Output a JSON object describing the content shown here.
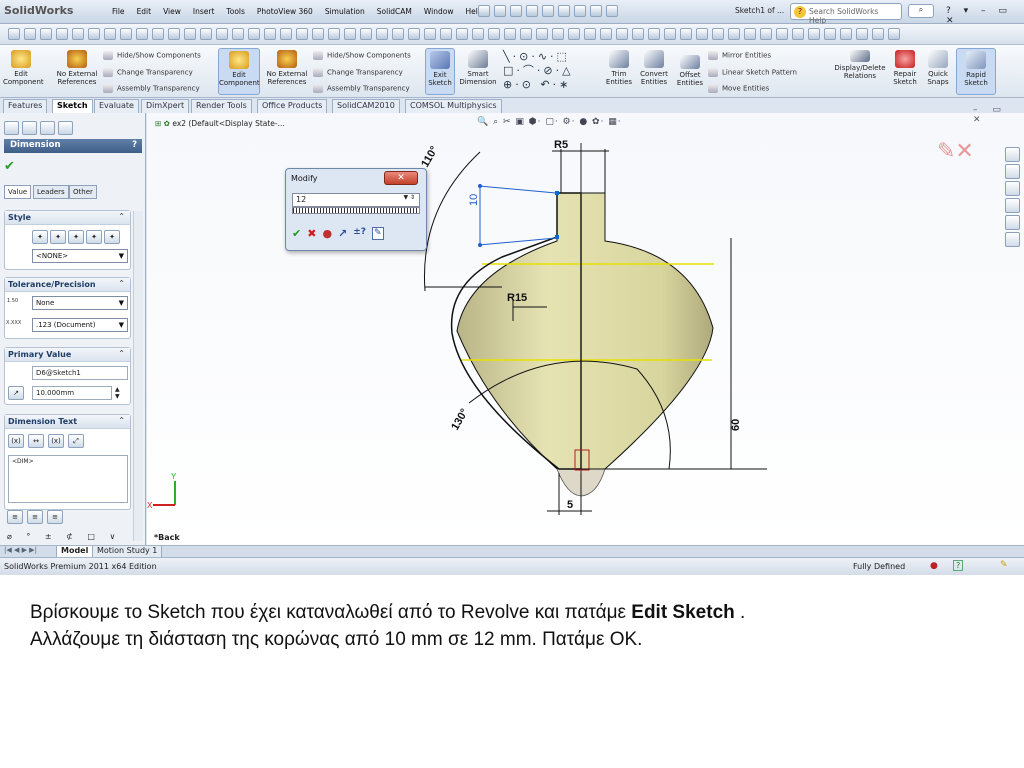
{
  "app": {
    "logo": "SolidWorks",
    "menu": [
      "File",
      "Edit",
      "View",
      "Insert",
      "Tools",
      "PhotoView 360",
      "Simulation",
      "SolidCAM",
      "Window",
      "Help"
    ],
    "doc_title": "Sketch1 of ...",
    "search_placeholder": "Search SolidWorks Help"
  },
  "ribbon": {
    "edit_component": "Edit Component",
    "no_external_refs": "No External References",
    "hide_show": "Hide/Show Components",
    "change_transparency": "Change Transparency",
    "assembly_transparency": "Assembly Transparency",
    "exit_sketch": "Exit Sketch",
    "smart_dimension": "Smart Dimension",
    "trim_entities": "Trim Entities",
    "convert_entities": "Convert Entities",
    "offset_entities": "Offset Entities",
    "mirror_entities": "Mirror Entities",
    "linear_pattern": "Linear Sketch Pattern",
    "move_entities": "Move Entities",
    "display_delete_relations": "Display/Delete Relations",
    "repair_sketch": "Repair Sketch",
    "quick_snaps": "Quick Snaps",
    "rapid_sketch": "Rapid Sketch"
  },
  "tabs": [
    "Features",
    "Sketch",
    "Evaluate",
    "DimXpert",
    "Render Tools",
    "Office Products",
    "SolidCAM2010",
    "COMSOL Multiphysics"
  ],
  "property_manager": {
    "title": "Dimension",
    "help": "?",
    "subtabs": [
      "Value",
      "Leaders",
      "Other"
    ],
    "style": {
      "label": "Style",
      "value": "<NONE>"
    },
    "tolerance": {
      "label": "Tolerance/Precision",
      "type": "None",
      "precision": ".123 (Document)",
      "icon1": "1.50",
      "icon2": "X.XXX"
    },
    "primary": {
      "label": "Primary Value",
      "name": "D6@Sketch1",
      "value": "10.000mm"
    },
    "dim_text": {
      "label": "Dimension Text",
      "content": "<DIM>"
    }
  },
  "viewport": {
    "tree_title": "ex2  (Default<Display State-...",
    "back_label": "*Back",
    "dims": {
      "r5": "R5",
      "d10": "10",
      "r15": "R15",
      "d60": "60",
      "d5": "5",
      "a110": "110°",
      "a130": "130°"
    },
    "axis_y": "Y",
    "axis_x": "X"
  },
  "modify": {
    "title": "Modify",
    "value": "12"
  },
  "bottom_tabs": [
    "Model",
    "Motion Study 1"
  ],
  "status": {
    "left": "SolidWorks Premium 2011 x64 Edition",
    "right": "Fully Defined"
  },
  "caption": {
    "line1_a": "Βρίσκουμε το Sketch που έχει καταναλωθεί από το Revolve και πατάμε ",
    "line1_bold": "Edit Sketch",
    "line1_b": " .",
    "line2": "Αλλάζουμε τη διάσταση της κορώνας από 10 mm σε 12 mm. Πατάμε OK."
  }
}
